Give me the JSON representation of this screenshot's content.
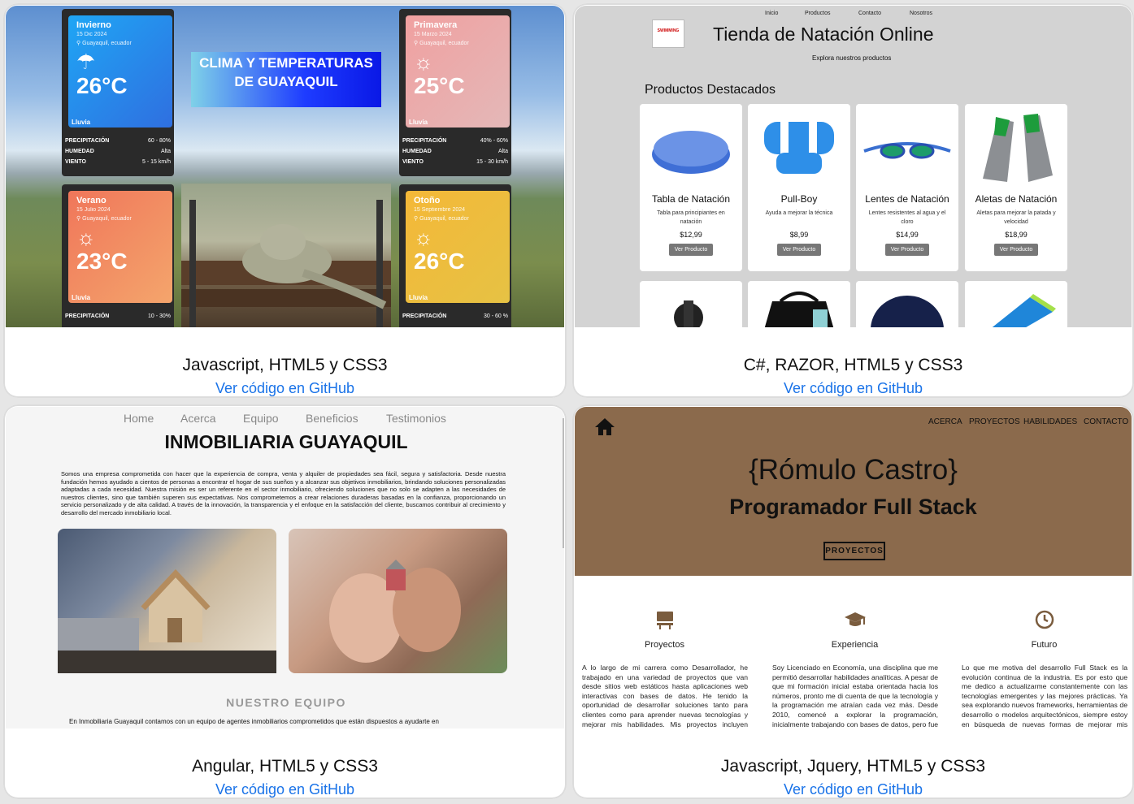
{
  "projects": [
    {
      "caption": "Javascript, HTML5 y CSS3",
      "link": "Ver código en GitHub"
    },
    {
      "caption": "C#, RAZOR, HTML5 y CSS3",
      "link": "Ver código en GitHub"
    },
    {
      "caption": "Angular, HTML5 y CSS3",
      "link": "Ver código en GitHub"
    },
    {
      "caption": "Javascript, Jquery, HTML5 y CSS3",
      "link": "Ver código en GitHub"
    }
  ],
  "weather": {
    "title": "CLIMA Y TEMPERATURAS DE GUAYAQUIL",
    "location": "Guayaquil, ecuador",
    "cards": [
      {
        "season": "Invierno",
        "date": "15 Dic 2024",
        "icon": "rain-cloud-icon",
        "temp": "26°C",
        "cond": "Lluvia",
        "color1": "#1f9bf0",
        "color2": "#2f6fe0",
        "rows": [
          [
            "PRECIPITACIÓN",
            "60 - 80%"
          ],
          [
            "HUMEDAD",
            "Alta"
          ],
          [
            "VIENTO",
            "5 - 15 km/h"
          ]
        ]
      },
      {
        "season": "Primavera",
        "date": "15 Marzo 2024",
        "icon": "sun-icon",
        "temp": "25°C",
        "cond": "Lluvia",
        "color1": "#f0a4a4",
        "color2": "#e2b6b6",
        "rows": [
          [
            "PRECIPITACIÓN",
            "40% - 60%"
          ],
          [
            "HUMEDAD",
            "Alta"
          ],
          [
            "VIENTO",
            "15 - 30 km/h"
          ]
        ]
      },
      {
        "season": "Verano",
        "date": "15 Julio 2024",
        "icon": "sun-icon",
        "temp": "23°C",
        "cond": "Lluvia",
        "color1": "#f07a5a",
        "color2": "#f4a06a",
        "rows": [
          [
            "PRECIPITACIÓN",
            "10 - 30%"
          ]
        ]
      },
      {
        "season": "Otoño",
        "date": "15 Septiembre 2024",
        "icon": "sun-icon",
        "temp": "26°C",
        "cond": "Lluvia",
        "color1": "#f2b83a",
        "color2": "#e8c040",
        "rows": [
          [
            "PRECIPITACIÓN",
            "30 - 60 %"
          ]
        ]
      }
    ]
  },
  "swim": {
    "nav": [
      "Inicio",
      "Productos",
      "Contacto",
      "Nosotros"
    ],
    "logo": "SWIMMING",
    "title": "Tienda de Natación Online",
    "subtitle": "Explora nuestros productos",
    "featured": "Productos Destacados",
    "products": [
      {
        "name": "Tabla de Natación",
        "desc": "Tabla para principiantes en natación",
        "price": "$12,99",
        "btn": "Ver Producto"
      },
      {
        "name": "Pull-Boy",
        "desc": "Ayuda a mejorar la técnica",
        "price": "$8,99",
        "btn": "Ver Producto"
      },
      {
        "name": "Lentes de Natación",
        "desc": "Lentes resistentes al agua y el cloro",
        "price": "$14,99",
        "btn": "Ver Producto"
      },
      {
        "name": "Aletas de Natación",
        "desc": "Aletas para mejorar la patada y velocidad",
        "price": "$18,99",
        "btn": "Ver Producto"
      }
    ]
  },
  "realestate": {
    "nav": [
      "Home",
      "Acerca",
      "Equipo",
      "Beneficios",
      "Testimonios"
    ],
    "title": "INMOBILIARIA GUAYAQUIL",
    "text": "Somos una empresa comprometida con hacer que la experiencia de compra, venta y alquiler de propiedades sea fácil, segura y satisfactoria. Desde nuestra fundación hemos ayudado a cientos de personas a encontrar el hogar de sus sueños y a alcanzar sus objetivos inmobiliarios, brindando soluciones personalizadas adaptadas a cada necesidad. Nuestra misión es ser un referente en el sector inmobiliario, ofreciendo soluciones que no solo se adapten a las necesidades de nuestros clientes, sino que también superen sus expectativas. Nos comprometemos a crear relaciones duraderas basadas en la confianza, proporcionando un servicio personalizado y de alta calidad. A través de la innovación, la transparencia y el enfoque en la satisfacción del cliente, buscamos contribuir al crecimiento y desarrollo del mercado inmobiliario local.",
    "team": "NUESTRO EQUIPO",
    "team_text": "En Inmobiliaria Guayaquil contamos con un equipo de agentes inmobiliarios comprometidos que están dispuestos a ayudarte en"
  },
  "portfolio": {
    "nav": [
      "ACERCA",
      "PROYECTOS",
      "HABILIDADES",
      "CONTACTO"
    ],
    "name": "{Rómulo Castro}",
    "role": "Programador Full Stack",
    "button": "PROYECTOS",
    "columns": [
      {
        "icon": "desk-icon",
        "heading": "Proyectos",
        "text": "A lo largo de mi carrera como Desarrollador, he trabajado en una variedad de proyectos que van desde sitios web estáticos hasta aplicaciones web interactivas con bases de datos. He tenido la oportunidad de desarrollar soluciones tanto para clientes como para aprender nuevas tecnologías y mejorar mis habilidades. Mis proyectos incluyen desde la creación de interfaces"
      },
      {
        "icon": "graduation-cap-icon",
        "heading": "Experiencia",
        "text": "Soy Licenciado en Economía, una disciplina que me permitió desarrollar habilidades analíticas. A pesar de que mi formación inicial estaba orientada hacia los números, pronto me di cuenta de que la tecnología y la programación me atraían cada vez más. Desde 2010, comencé a explorar la programación, inicialmente trabajando con bases de datos, pero fue en los últimos"
      },
      {
        "icon": "clock-icon",
        "heading": "Futuro",
        "text": "Lo que me motiva del desarrollo Full Stack es la evolución continua de la industria. Es por esto que me dedico a actualizarme constantemente con las tecnologías emergentes y las mejores prácticas. Ya sea explorando nuevos frameworks, herramientas de desarrollo o modelos arquitectónicos, siempre estoy en búsqueda de nuevas formas de mejorar mis habilidades"
      }
    ]
  }
}
